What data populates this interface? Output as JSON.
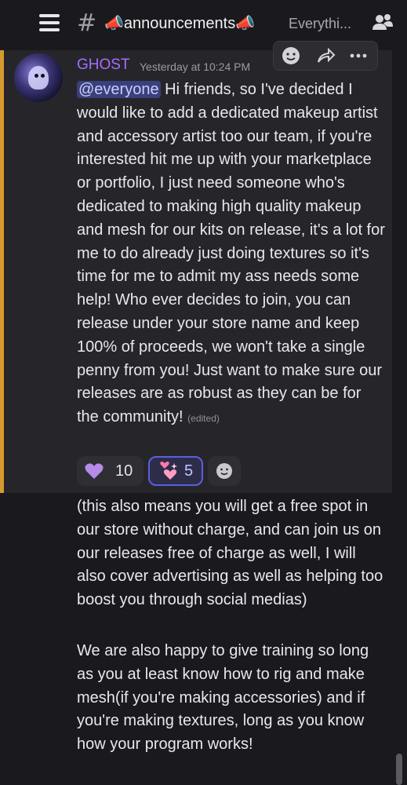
{
  "header": {
    "channel_name": "announcements",
    "topic": "Everythi..."
  },
  "message": {
    "author": "GHOST",
    "author_color": "#a66cff",
    "timestamp": "Yesterday at 10:24 PM",
    "mention": "@everyone",
    "body": "Hi friends, so I've decided I would like to add a dedicated makeup artist and accessory artist too our team, if you're interested hit me up with your marketplace or portfolio, I just need someone who's dedicated to making high quality makeup and mesh for our kits on release, it's a lot for me to do already just doing textures so it's time for me to admit my ass needs some help! Who ever decides to join, you can release under your store name and keep 100% of proceeds, we won't take a single penny from you! Just want to make sure our releases are as robust as they can be for the community!",
    "edited_label": "(edited)",
    "reactions": [
      {
        "icon": "purple-heart-icon",
        "count": "10"
      },
      {
        "icon": "sparkling-heart-icon",
        "count": "5"
      }
    ]
  },
  "follow_ups": [
    {
      "text": "(this also means you will get a free spot in our store without charge, and can join us on our releases free of charge as well, I will also cover advertising as well as helping too boost you through social medias)"
    },
    {
      "text": "We are also happy to give training so long as you at least know how to rig and make mesh(if you're making accessories) and if you're making textures, long as you know how your program works!"
    }
  ],
  "colors": {
    "background": "#1a1a1e",
    "highlight": "#26262a",
    "highlight_border": "#d79a2f",
    "mention_bg": "#3b3f7a"
  }
}
